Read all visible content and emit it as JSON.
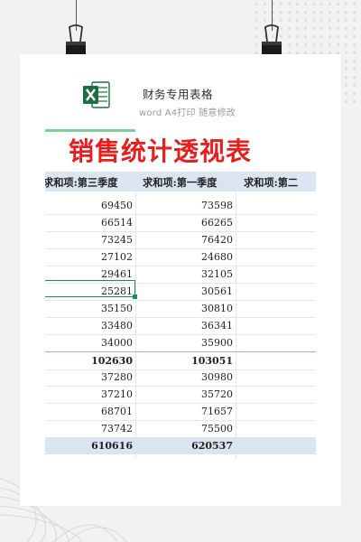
{
  "header": {
    "title": "财务专用表格",
    "subtitle": "word A4打印 随意修改"
  },
  "sheet": {
    "title": "销售统计透视表",
    "columns": [
      "求和项:第三季度",
      "求和项:第一季度",
      "求和项:第二"
    ],
    "rows": [
      {
        "q3": "69450",
        "q1": "73598"
      },
      {
        "q3": "66514",
        "q1": "66265"
      },
      {
        "q3": "73245",
        "q1": "76420"
      },
      {
        "q3": "27102",
        "q1": "24680"
      },
      {
        "q3": "29461",
        "q1": "32105"
      },
      {
        "q3": "25281",
        "q1": "30561"
      },
      {
        "q3": "35150",
        "q1": "30810"
      },
      {
        "q3": "33480",
        "q1": "36341"
      },
      {
        "q3": "34000",
        "q1": "35900"
      },
      {
        "q3": "102630",
        "q1": "103051"
      },
      {
        "q3": "37280",
        "q1": "30980"
      },
      {
        "q3": "37210",
        "q1": "35720"
      },
      {
        "q3": "68701",
        "q1": "71657"
      },
      {
        "q3": "73742",
        "q1": "75500"
      },
      {
        "q3": "610616",
        "q1": "620537"
      }
    ]
  },
  "colors": {
    "title_red": "#e61e1e",
    "header_fill": "#dbe5f1",
    "excel_green": "#1d6f42",
    "selection_green": "#1d8a4e"
  }
}
